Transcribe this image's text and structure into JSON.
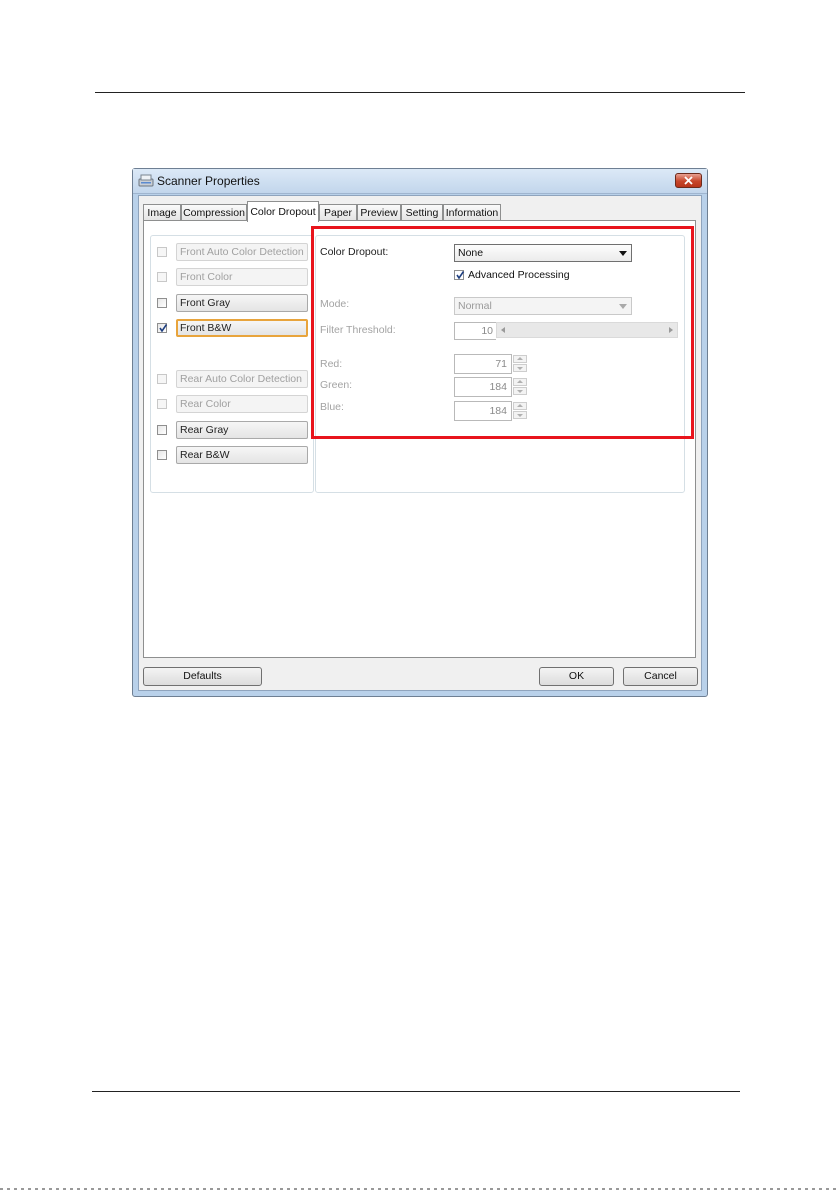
{
  "window": {
    "title": "Scanner Properties"
  },
  "tabs": [
    {
      "label": "Image"
    },
    {
      "label": "Compression"
    },
    {
      "label": "Color Dropout",
      "active": true
    },
    {
      "label": "Paper"
    },
    {
      "label": "Preview"
    },
    {
      "label": "Setting"
    },
    {
      "label": "Information"
    }
  ],
  "image_list": [
    {
      "label": "Front Auto Color Detection",
      "checked": false,
      "enabled": false
    },
    {
      "label": "Front Color",
      "checked": false,
      "enabled": false
    },
    {
      "label": "Front Gray",
      "checked": false,
      "enabled": true
    },
    {
      "label": "Front B&W",
      "checked": true,
      "enabled": true,
      "focused": true
    },
    {
      "label": "Rear Auto Color Detection",
      "checked": false,
      "enabled": false
    },
    {
      "label": "Rear Color",
      "checked": false,
      "enabled": false
    },
    {
      "label": "Rear Gray",
      "checked": false,
      "enabled": true
    },
    {
      "label": "Rear B&W",
      "checked": false,
      "enabled": true
    }
  ],
  "dropout": {
    "color_dropout_label": "Color Dropout:",
    "color_dropout_value": "None",
    "advanced_processing_label": "Advanced Processing",
    "advanced_processing_checked": true,
    "mode_label": "Mode:",
    "mode_value": "Normal",
    "filter_threshold_label": "Filter Threshold:",
    "filter_threshold_value": "10",
    "red_label": "Red:",
    "red_value": "71",
    "green_label": "Green:",
    "green_value": "184",
    "blue_label": "Blue:",
    "blue_value": "184"
  },
  "footer": {
    "defaults_label": "Defaults",
    "ok_label": "OK",
    "cancel_label": "Cancel"
  },
  "colors": {
    "highlight_box": "#e8141c",
    "focus_border": "#e8a43c",
    "window_frame": "#b9d1ea"
  }
}
